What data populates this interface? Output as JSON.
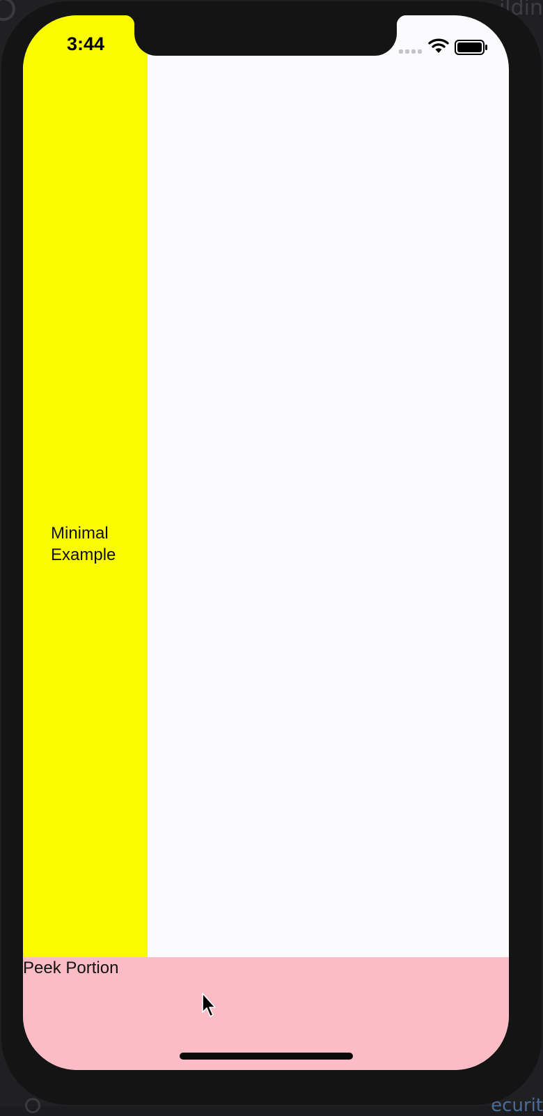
{
  "status_bar": {
    "time": "3:44"
  },
  "panels": {
    "main_panel_label": "Minimal\nExample",
    "peek_label": "Peek Portion"
  },
  "background": {
    "top_right_fragment": "ildin",
    "bottom_right_fragment": "ecurit"
  },
  "colors": {
    "yellow_panel": "#fbfb00",
    "peek_panel": "#fcbcc6",
    "screen_background": "#fbfbfd",
    "device_frame": "#141414"
  },
  "icons": {
    "status": [
      "cellular-signal-icon",
      "wifi-icon",
      "battery-icon"
    ],
    "pointer": "mouse-cursor-icon"
  }
}
